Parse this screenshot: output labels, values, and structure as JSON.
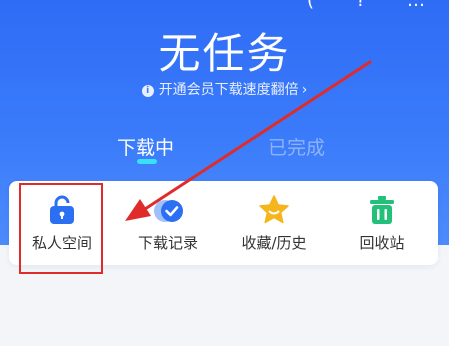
{
  "header": {
    "status_fragments": [
      "(",
      "?",
      "…"
    ],
    "title": "无任务",
    "promo_text": "开通会员下载速度翻倍",
    "promo_icon": "info-icon",
    "promo_chevron": "›"
  },
  "tabs": [
    {
      "label": "下载中",
      "active": true
    },
    {
      "label": "已完成",
      "active": false
    }
  ],
  "tools": [
    {
      "label": "私人空间",
      "icon": "unlock-icon",
      "color": "#2b6ff3"
    },
    {
      "label": "下载记录",
      "icon": "download-check-icon",
      "color": "#2b6ff3"
    },
    {
      "label": "收藏/历史",
      "icon": "star-icon",
      "color": "#f6b51c"
    },
    {
      "label": "回收站",
      "icon": "trash-icon",
      "color": "#23c07a"
    }
  ],
  "annotation": {
    "color": "#e02b2b",
    "target": "私人空间"
  }
}
